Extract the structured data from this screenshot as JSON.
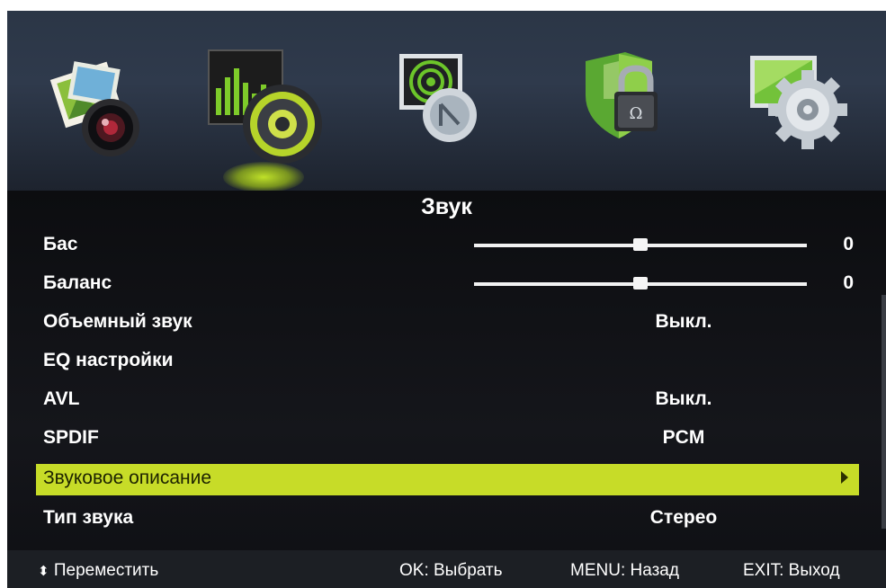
{
  "top_icons": [
    {
      "name": "picture-icon",
      "selected": false
    },
    {
      "name": "sound-icon",
      "selected": true
    },
    {
      "name": "channel-icon",
      "selected": false
    },
    {
      "name": "lock-icon",
      "selected": false
    },
    {
      "name": "settings-icon",
      "selected": false
    }
  ],
  "menu": {
    "title": "Звук",
    "items": [
      {
        "label": "Бас",
        "value": "0",
        "slider": 0.5
      },
      {
        "label": "Баланс",
        "value": "0",
        "slider": 0.5
      },
      {
        "label": "Объемный звук",
        "value": "Выкл."
      },
      {
        "label": "EQ настройки",
        "value": ""
      },
      {
        "label": "AVL",
        "value": "Выкл."
      },
      {
        "label": "SPDIF",
        "value": "PCM"
      },
      {
        "label": "Звуковое описание",
        "value": "",
        "selected": true
      },
      {
        "label": "Тип звука",
        "value": "Стерео"
      }
    ]
  },
  "footer": {
    "move": "Переместить",
    "ok": "OK: Выбрать",
    "menu": "MENU: Назад",
    "exit": "EXIT: Выход"
  },
  "colors": {
    "highlight": "#c7dc28",
    "background": "#111216",
    "text": "#ffffff"
  }
}
